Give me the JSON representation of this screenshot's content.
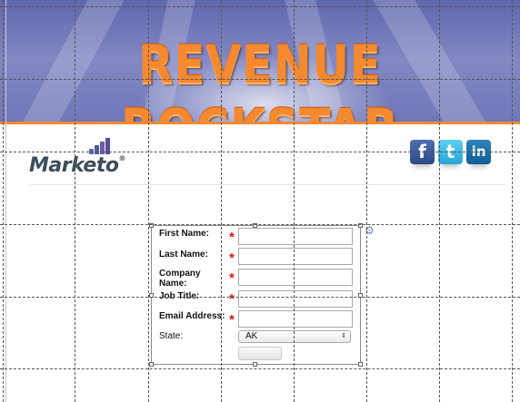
{
  "banner": {
    "title": "REVENUE ROCKSTAR"
  },
  "logo": {
    "text": "Marketo",
    "trademark": "®"
  },
  "social": {
    "facebook": "f",
    "twitter": "t",
    "linkedin": "in"
  },
  "form": {
    "fields": [
      {
        "label": "First Name:",
        "required": "*",
        "value": ""
      },
      {
        "label": "Last Name:",
        "required": "*",
        "value": ""
      },
      {
        "label_line1": "Company",
        "label_line2": "Name:",
        "required": "*",
        "value": ""
      },
      {
        "label": "Job Title:",
        "required": "*",
        "value": ""
      },
      {
        "label": "Email Address:",
        "required": "*",
        "value": ""
      }
    ],
    "state": {
      "label": "State:",
      "selected": "AK",
      "arrows": "⇕"
    }
  },
  "colors": {
    "banner_orange": "#f4892f",
    "banner_blue": "#6f76b8",
    "required_red": "#d11a1a",
    "facebook": "#3b5998",
    "twitter": "#33b5e5",
    "linkedin": "#0e76a8"
  }
}
